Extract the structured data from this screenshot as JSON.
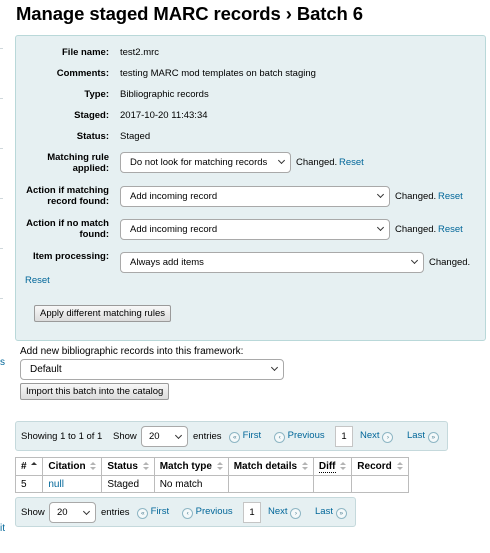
{
  "page": {
    "title": "Manage staged MARC records › Batch 6"
  },
  "left_edge": {
    "fragment_1": "s",
    "fragment_2": "it"
  },
  "summary": {
    "fields": [
      {
        "label": "File name:",
        "value": "test2.mrc"
      },
      {
        "label": "Comments:",
        "value": "testing MARC mod templates on batch staging"
      },
      {
        "label": "Type:",
        "value": "Bibliographic records"
      },
      {
        "label": "Staged:",
        "value": "2017-10-20 11:43:34"
      },
      {
        "label": "Status:",
        "value": "Staged"
      }
    ],
    "matching_rule": {
      "label": "Matching rule applied:",
      "selected": "Do not look for matching records",
      "changed": "Changed.",
      "reset": "Reset"
    },
    "action_if_matching": {
      "label": "Action if matching record found:",
      "selected": "Add incoming record",
      "changed": "Changed.",
      "reset": "Reset"
    },
    "action_if_no_match": {
      "label": "Action if no match found:",
      "selected": "Add incoming record",
      "changed": "Changed.",
      "reset": "Reset"
    },
    "item_processing": {
      "label": "Item processing:",
      "selected": "Always add items",
      "changed": "Changed."
    },
    "reset_link": "Reset",
    "apply_button": "Apply different matching rules"
  },
  "framework": {
    "label": "Add new bibliographic records into this framework:",
    "selected": "Default",
    "import_button": "Import this batch into the catalog"
  },
  "pager_top": {
    "info": "Showing 1 to 1 of 1",
    "show_label": "Show",
    "page_size": "20",
    "entries_label": "entries",
    "first": "First",
    "previous": "Previous",
    "current_page": "1",
    "next": "Next",
    "last": "Last"
  },
  "table": {
    "headers": [
      "#",
      "Citation",
      "Status",
      "Match type",
      "Match details",
      "Diff",
      "Record"
    ],
    "rows": [
      {
        "num": "5",
        "citation": "null",
        "status": "Staged",
        "match_type": "No match",
        "match_details": "",
        "diff": "",
        "record": ""
      }
    ]
  },
  "pager_bottom": {
    "show_label": "Show",
    "page_size": "20",
    "entries_label": "entries",
    "first": "First",
    "previous": "Previous",
    "current_page": "1",
    "next": "Next",
    "last": "Last"
  },
  "icons": {
    "first": "double-chevron-left-icon",
    "previous": "chevron-left-icon",
    "next": "chevron-right-icon",
    "last": "double-chevron-right-icon",
    "sort": "sort-arrows-icon",
    "dropdown": "chevron-down-icon"
  },
  "colors": {
    "link": "#006699",
    "panel_bg": "#e6f0f2",
    "panel_border": "#b9d8d9"
  }
}
